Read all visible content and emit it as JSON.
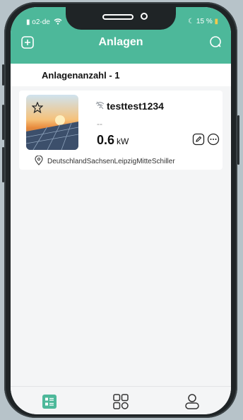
{
  "status": {
    "carrier": "o2-de",
    "battery": "15 %"
  },
  "header": {
    "title": "Anlagen",
    "add_icon": "plus-square-icon",
    "search_icon": "search-icon"
  },
  "summary": {
    "count_label": "Anlagenanzahl - 1"
  },
  "plant": {
    "name": "testtest1234",
    "subtitle": "--",
    "power_value": "0.6",
    "power_unit": "kW",
    "location": "DeutschlandSachsenLeipzigMitteSchiller",
    "icons": [
      "star-icon",
      "wifi-off-icon",
      "edit-icon",
      "more-icon",
      "location-pin-icon"
    ]
  },
  "tabs": [
    {
      "name": "list-tab",
      "icon": "list-icon",
      "active": true
    },
    {
      "name": "grid-tab",
      "icon": "grid-icon",
      "active": false
    },
    {
      "name": "profile-tab",
      "icon": "user-icon",
      "active": false
    }
  ],
  "colors": {
    "accent": "#4db89a",
    "background": "#f4f5f6"
  }
}
